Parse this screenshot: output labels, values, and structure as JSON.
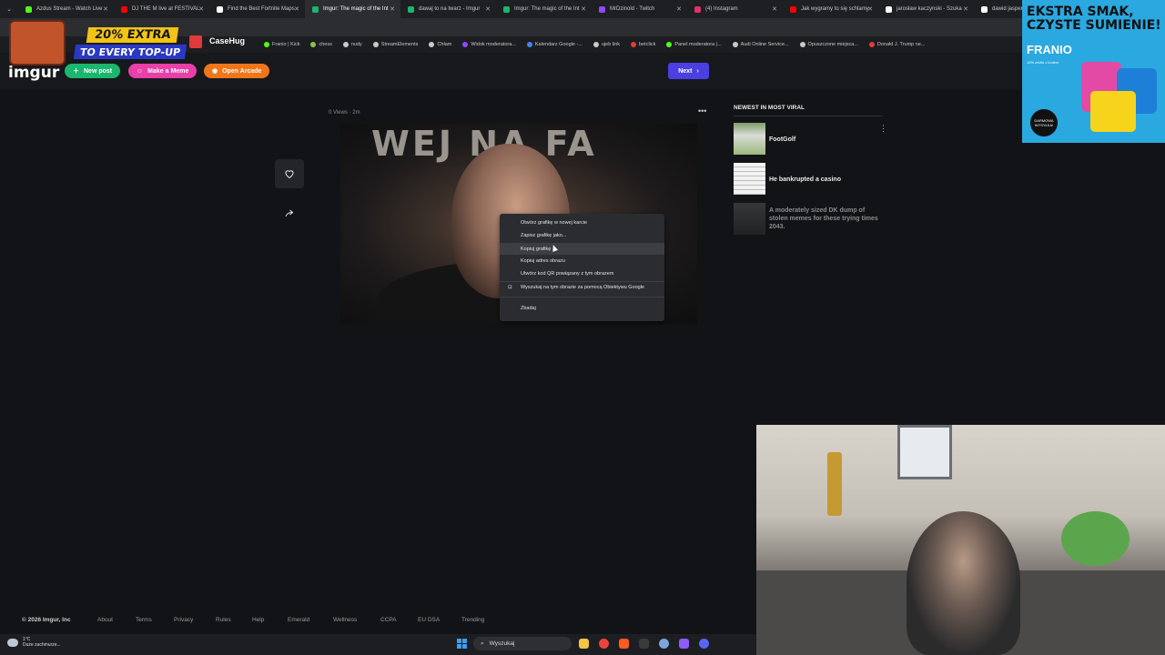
{
  "browser": {
    "tabs": [
      {
        "title": "Azdus Stream - Watch Live",
        "color": "#53fc18",
        "active": false
      },
      {
        "title": "DJ THE M live at FESTIVAL",
        "color": "#ff0000",
        "active": false
      },
      {
        "title": "Find the Best Fortnite Maps",
        "color": "#ffffff",
        "active": false
      },
      {
        "title": "Imgur: The magic of the Int",
        "color": "#1bb76e",
        "active": true
      },
      {
        "title": "dawaj to na twarz - Imgur",
        "color": "#1bb76e",
        "active": false
      },
      {
        "title": "Imgur: The magic of the Int",
        "color": "#1bb76e",
        "active": false
      },
      {
        "title": "MrDzinold - Twitch",
        "color": "#9146ff",
        "active": false
      },
      {
        "title": "(4) Instagram",
        "color": "#e1306c",
        "active": false
      },
      {
        "title": "Jak wygramy to się schlamy",
        "color": "#ff0000",
        "active": false
      },
      {
        "title": "jarosław kaczynski - Szuka",
        "color": "#ffffff",
        "active": false
      },
      {
        "title": "dawid jasper - Sz",
        "color": "#ffffff",
        "active": false
      }
    ],
    "bookmarks": [
      {
        "label": "Franio | Kick",
        "color": "#53fc18"
      },
      {
        "label": "chess",
        "color": "#8bc34a"
      },
      {
        "label": "nudy",
        "color": "#c9c9c9"
      },
      {
        "label": "StreamElements",
        "color": "#c9c9c9"
      },
      {
        "label": "Chłam",
        "color": "#c9c9c9"
      },
      {
        "label": "Widok moderatora...",
        "color": "#9146ff"
      },
      {
        "label": "Kalendarz Google -...",
        "color": "#4285f4"
      },
      {
        "label": "ujeb link",
        "color": "#c9c9c9"
      },
      {
        "label": "betclick",
        "color": "#e53935"
      },
      {
        "label": "Panel moderatora |...",
        "color": "#53fc18"
      },
      {
        "label": "Audi Online Service...",
        "color": "#c9c9c9"
      },
      {
        "label": "Opuszczone miejsca...",
        "color": "#c9c9c9"
      },
      {
        "label": "Donald J. Trump ne...",
        "color": "#e53935"
      }
    ]
  },
  "imgur": {
    "logo": "imgur",
    "new_post": "New post",
    "make_meme": "Make a Meme",
    "open_arcade": "Open Arcade",
    "next": "Next",
    "meta": "0 Views · 2m",
    "image_text": "WEJ NA FA",
    "sidebar_title": "NEWEST IN MOST VIRAL",
    "sidebar_items": [
      {
        "title": "FootGolf"
      },
      {
        "title": "He bankrupted a casino"
      },
      {
        "title": "A moderately sized DK dump of stolen memes for these trying times 2043."
      }
    ],
    "footer_links": [
      "About",
      "Terms",
      "Privacy",
      "Rules",
      "Help",
      "Emerald",
      "Wellness",
      "CCPA",
      "EU DSA",
      "Trending"
    ],
    "copyright": "© 2026 Imgur, Inc"
  },
  "context_menu": {
    "items": [
      "Otwórz grafikę w nowej karcie",
      "Zapisz grafikę jako...",
      "Kopiuj grafikę",
      "Kopiuj adres obrazu",
      "Utwórz kod QR powiązany z tym obrazem",
      "Wyszukaj na tym obrazie za pomocą Obiektywu Google"
    ],
    "inspect": "Zbadaj"
  },
  "ad": {
    "line1": "EKSTRA SMAK,",
    "line2": "CZYSTE SUMIENIE!",
    "brand": "FRANIO",
    "sub": "10% zniżki z kodem",
    "badge": "DARMOWA WYSYŁKA!"
  },
  "casehug": {
    "line1": "20% EXTRA",
    "line2": "TO EVERY TOP-UP",
    "logo": "CaseHug"
  },
  "taskbar": {
    "weather_temp": "1°C",
    "weather_desc": "Duże zachmurze...",
    "search": "Wyszukaj"
  }
}
